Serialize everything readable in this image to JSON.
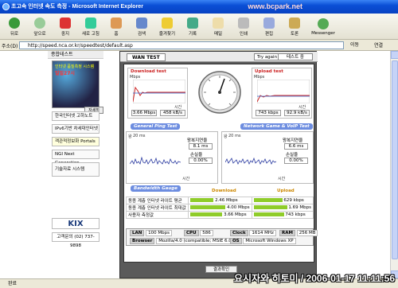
{
  "window": {
    "title": "초고속 인터넷 속도 측정 - Microsoft Internet Explorer",
    "watermark": "www.bcpark.net"
  },
  "toolbar": {
    "back": "뒤로",
    "forward": "앞으로",
    "stop": "중지",
    "refresh": "새로 고침",
    "home": "홈",
    "search": "검색",
    "favorites": "즐겨찾기",
    "history": "기록",
    "mail": "메일",
    "print": "인쇄",
    "edit": "편집",
    "discuss": "토론",
    "messenger": "Messenger"
  },
  "address": {
    "label": "주소(D)",
    "url": "http://speed.nca.or.kr/speedtest/default.asp",
    "go": "이동",
    "links": "연결"
  },
  "sidebar": {
    "header": "종합테스트",
    "banner_title": "인터넷 품질측정 시스템",
    "banner_sub": "일일27시",
    "banner_btn": "자세히",
    "items": [
      "한국인터넷 고하노트",
      "IPv6기반 차세대인터넷",
      "객관적정보화 Portals",
      "NGI Next Generation",
      "기술자료 시스템"
    ],
    "kix": "KIX",
    "phone": "고객문의 (02) 737-9898"
  },
  "speedtest": {
    "tab": "WAN TEST",
    "try_again": "Try again",
    "input_value": "테스트 중",
    "download": {
      "title": "Download test",
      "unit": "Mbps",
      "time_label": "시간",
      "speed_mbps": "3.66 Mbps",
      "speed_kbs": "458 kB/s"
    },
    "upload": {
      "title": "Upload test",
      "unit": "Mbps",
      "time_label": "시간",
      "speed_kbps": "743 kbps",
      "speed_kbs": "92.9 kB/s"
    },
    "ping": {
      "title": "General Ping Test",
      "ylabel": "왕",
      "yunit": "20 ms",
      "time_label": "시간",
      "avg_label": "왕복지연율",
      "avg_value": "8.1 ms",
      "loss_label": "손실율",
      "loss_value": "0.00%"
    },
    "voip": {
      "title": "Network Game & VoIP Test",
      "ylabel": "왕",
      "yunit": "20 ms",
      "time_label": "시간",
      "avg_label": "왕복지연율",
      "avg_value": "6.6 ms",
      "loss_label": "손실율",
      "loss_value": "0.00%"
    },
    "bandwidth": {
      "title": "Bandwidth Gauge",
      "download_header": "Download",
      "upload_header": "Upload",
      "rows": [
        {
          "label": "동종 계층 인터넷 라이트 평균",
          "download": "2.46 Mbps",
          "download_frac": 0.67,
          "upload": "629 kbps",
          "upload_frac": 0.85
        },
        {
          "label": "동종 계층 인터넷 라이트 최대값",
          "download": "4.00 Mbps",
          "download_frac": 1.0,
          "upload": "1.69 Mbps",
          "upload_frac": 1.0
        },
        {
          "label": "사용자 측정값",
          "download": "3.66 Mbps",
          "download_frac": 0.92,
          "upload": "743 kbps",
          "upload_frac": 0.9
        }
      ]
    },
    "system": {
      "lan_label": "LAN",
      "lan_value": "100 Mbps",
      "cpu_label": "CPU",
      "cpu_value": "586",
      "clock_label": "Clock",
      "clock_value": "1614 MHz",
      "ram_label": "RAM",
      "ram_value": "256 MB",
      "browser_label": "Browser",
      "browser_value": "Mozilla/4.0 (compatible; MSIE 6.0",
      "os_label": "OS",
      "os_value": "Microsoft Windows XP"
    },
    "result_button": "결과확인"
  },
  "status": {
    "text": "완료",
    "stamp": "요시자와 히토미 / 2006-01-17 11:11:56"
  }
}
